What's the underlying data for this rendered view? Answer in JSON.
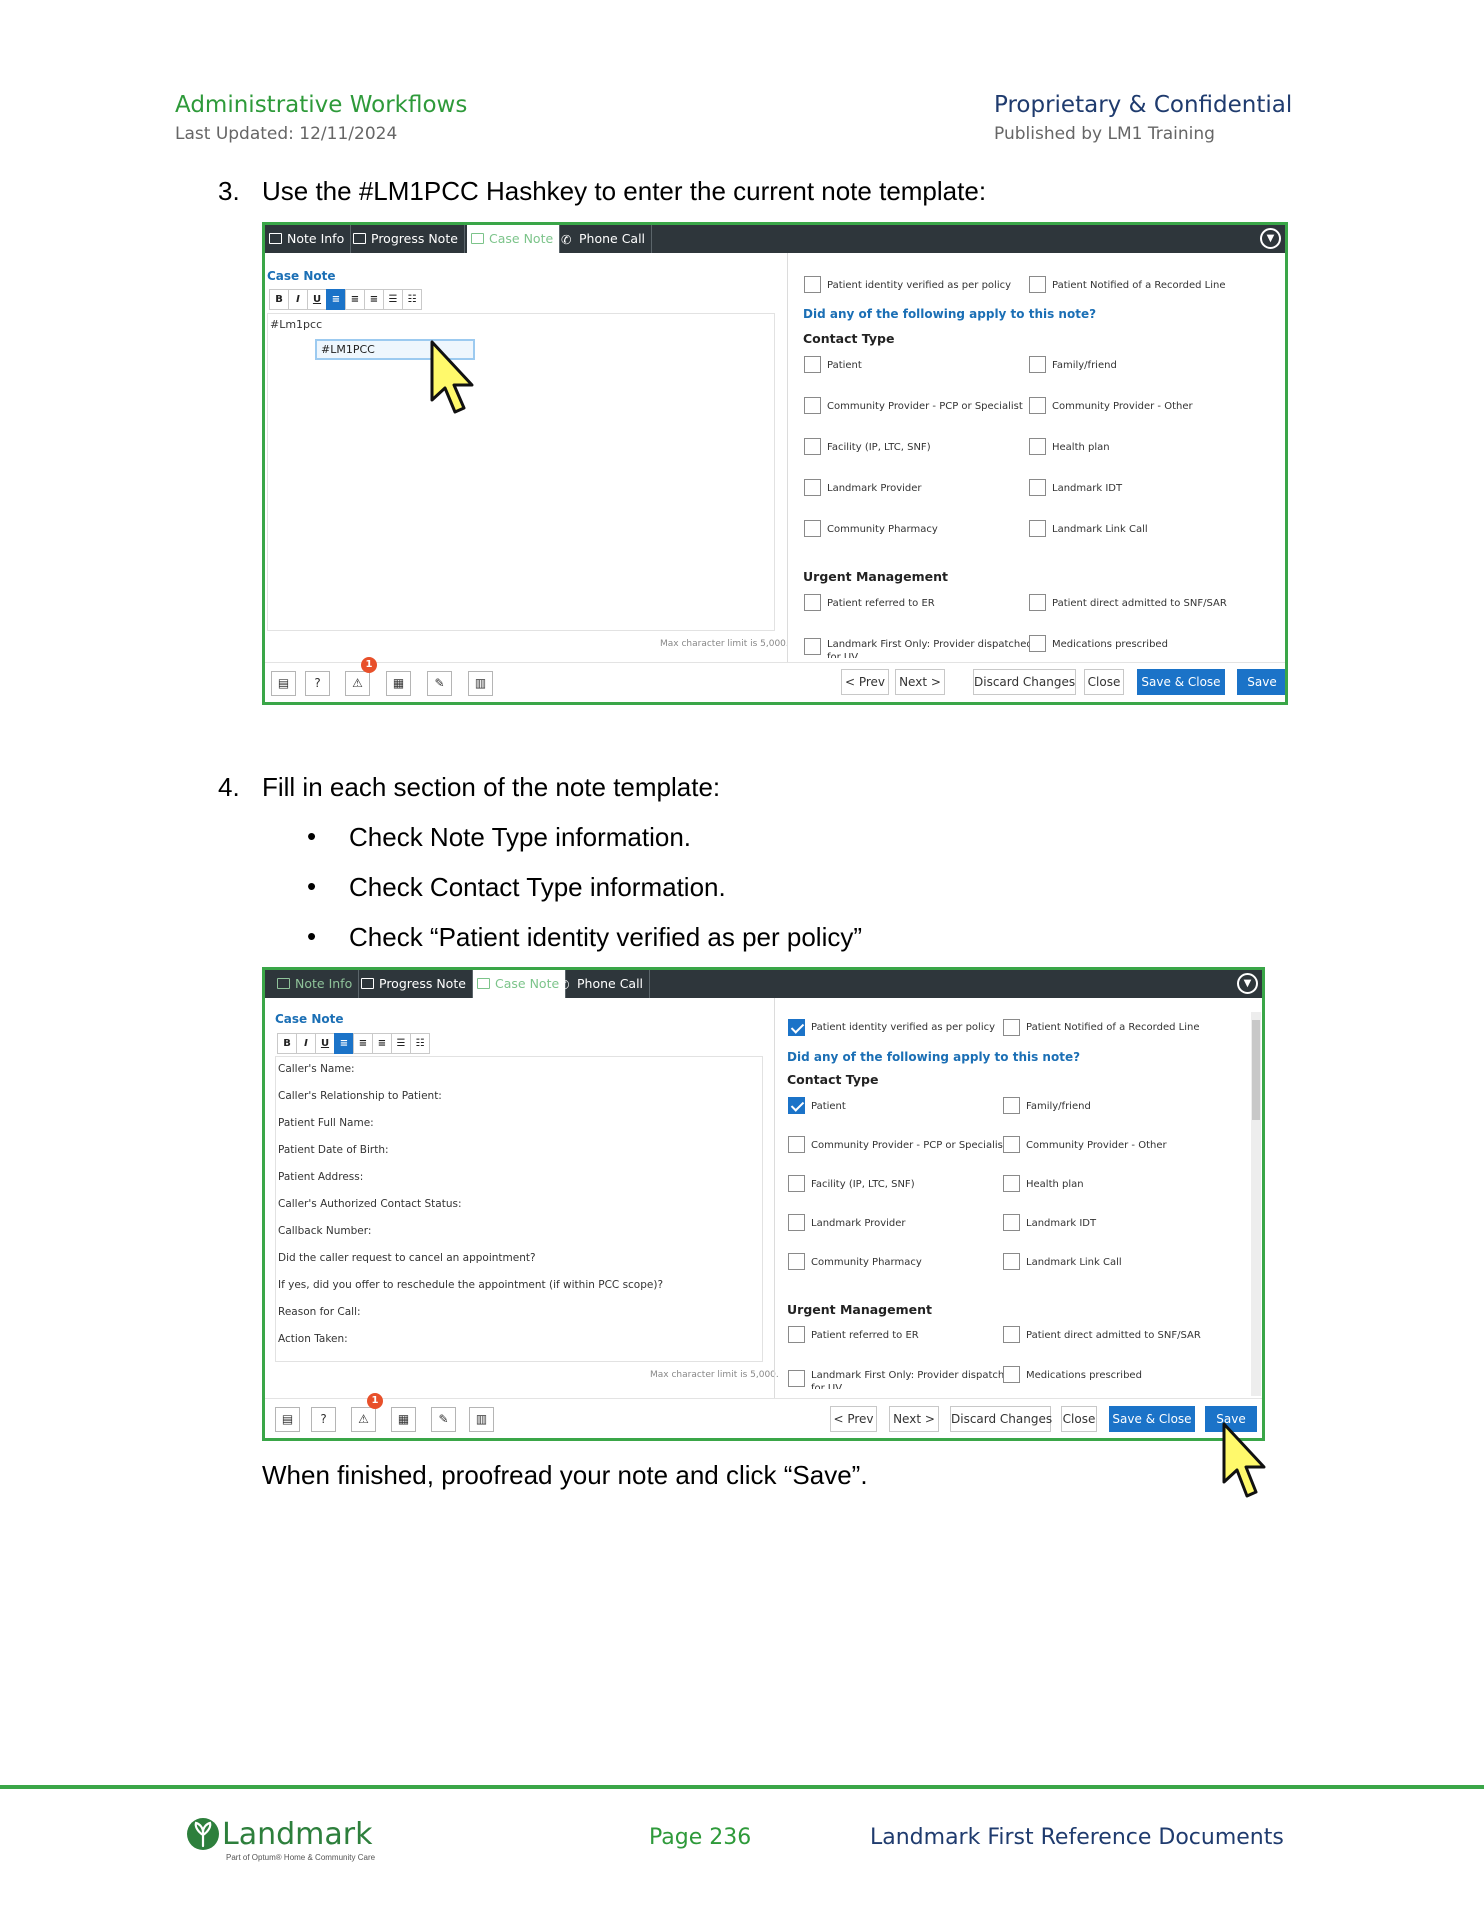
{
  "header": {
    "title": "Administrative Workflows",
    "last_updated": "Last Updated: 12/11/2024",
    "right_title": "Proprietary & Confidential",
    "right_sub": "Published by LM1 Training"
  },
  "step3": {
    "number": "3.",
    "text": "Use the #LM1PCC Hashkey to enter the current note template:"
  },
  "step4": {
    "number": "4.",
    "text": "Fill in each section of the note template:",
    "bullets": [
      "Check Note Type information.",
      "Check Contact Type information.",
      "Check  “Patient identity verified as per policy”"
    ],
    "bullet_glyph": "•"
  },
  "closing": "When finished, proofread your note and click “Save”.",
  "tabs": [
    "Note Info",
    "Progress Note",
    "Case Note",
    "Phone Call"
  ],
  "case_note_label": "Case Note",
  "format_buttons": [
    "B",
    "I",
    "U",
    "≡",
    "≡",
    "≡",
    "☰",
    "☷"
  ],
  "editor1": {
    "typed": "#Lm1pcc",
    "suggestion": "#LM1PCC"
  },
  "max_char": "Max character limit is 5,000.",
  "form": {
    "identity_verified": "Patient identity verified as per policy",
    "recorded_line": "Patient Notified of a Recorded Line",
    "question": "Did any of the following apply to this note?",
    "contact_type_heading": "Contact Type",
    "contact_types": [
      "Patient",
      "Family/friend",
      "Community Provider - PCP or Specialist",
      "Community Provider - Other",
      "Facility (IP, LTC, SNF)",
      "Health plan",
      "Landmark Provider",
      "Landmark IDT",
      "Community Pharmacy",
      "Landmark Link Call"
    ],
    "urgent_heading": "Urgent Management",
    "urgent": [
      "Patient referred to ER",
      "Patient direct admitted to SNF/SAR",
      "Landmark First Only: Provider dispatched",
      "Medications prescribed"
    ],
    "cut_text": "for UV"
  },
  "template_lines": [
    "Caller's Name:",
    "Caller's Relationship to Patient:",
    "Patient Full Name:",
    "Patient Date of Birth:",
    "Patient Address:",
    "Caller's Authorized Contact Status:",
    "Callback Number:",
    "Did the caller request to cancel an appointment?",
    "If yes, did you offer to reschedule the appointment (if within PCC scope)?",
    "Reason for Call:",
    "Action Taken:"
  ],
  "footer_buttons": [
    "< Prev",
    "Next >",
    "Discard Changes",
    "Close",
    "Save & Close",
    "Save"
  ],
  "footer_icons": [
    "notes-icon",
    "help-icon",
    "warning-icon",
    "form-icon",
    "edit-icon",
    "clipboard-icon"
  ],
  "alert_count": "1",
  "screenshot2_checked": {
    "identity_verified": true,
    "patient": true
  },
  "colors": {
    "brand_green": "#3aa648",
    "primary_blue": "#1b73c8",
    "tab_dark": "#2e363b",
    "badge": "#e8502a"
  },
  "page_footer": {
    "logo_word": "Landmark",
    "logo_sub": "Part of Optum® Home & Community Care",
    "page": "Page 236",
    "doc_title": "Landmark First Reference Documents"
  }
}
